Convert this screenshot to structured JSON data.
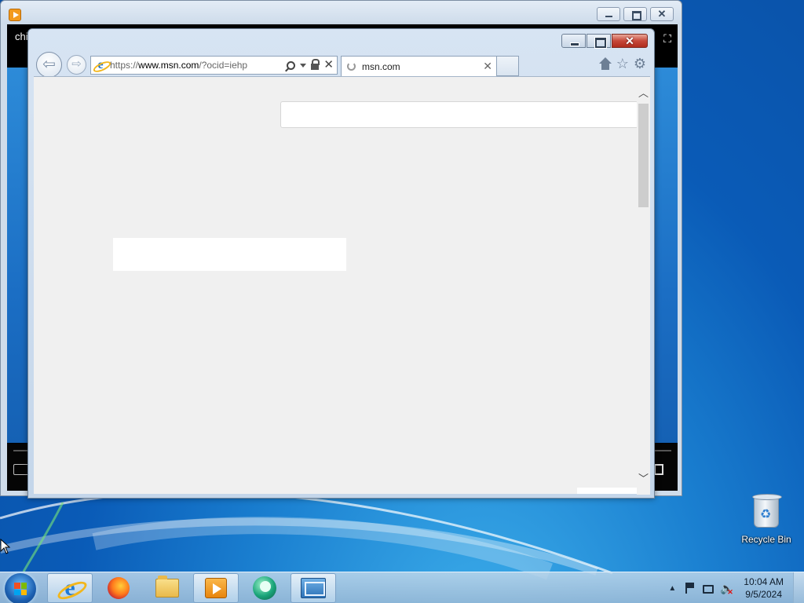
{
  "media_player": {
    "title_fragment": "chi"
  },
  "browser": {
    "address_bar": {
      "protocol": "https://",
      "host": "www.msn.com",
      "path": "/?ocid=iehp"
    },
    "tab": {
      "label": "msn.com"
    }
  },
  "desktop": {
    "recycle_bin_label": "Recycle Bin"
  },
  "taskbar": {
    "apps": [
      {
        "name": "internet-explorer",
        "icon": "ie-icon",
        "active": true
      },
      {
        "name": "firefox",
        "icon": "firefox-icon",
        "active": false
      },
      {
        "name": "windows-explorer",
        "icon": "folder-icon",
        "active": false
      },
      {
        "name": "media-player",
        "icon": "media-player-icon",
        "active": false
      },
      {
        "name": "globe-app",
        "icon": "globe-icon",
        "active": false
      },
      {
        "name": "remote-desktop",
        "icon": "rdp-icon",
        "active": true
      }
    ],
    "clock": {
      "time": "10:04 AM",
      "date": "9/5/2024"
    }
  },
  "colors": {
    "desktop_blue": "#1a7fd0",
    "close_red": "#c6483a",
    "page_bg": "#f0f0f0"
  }
}
